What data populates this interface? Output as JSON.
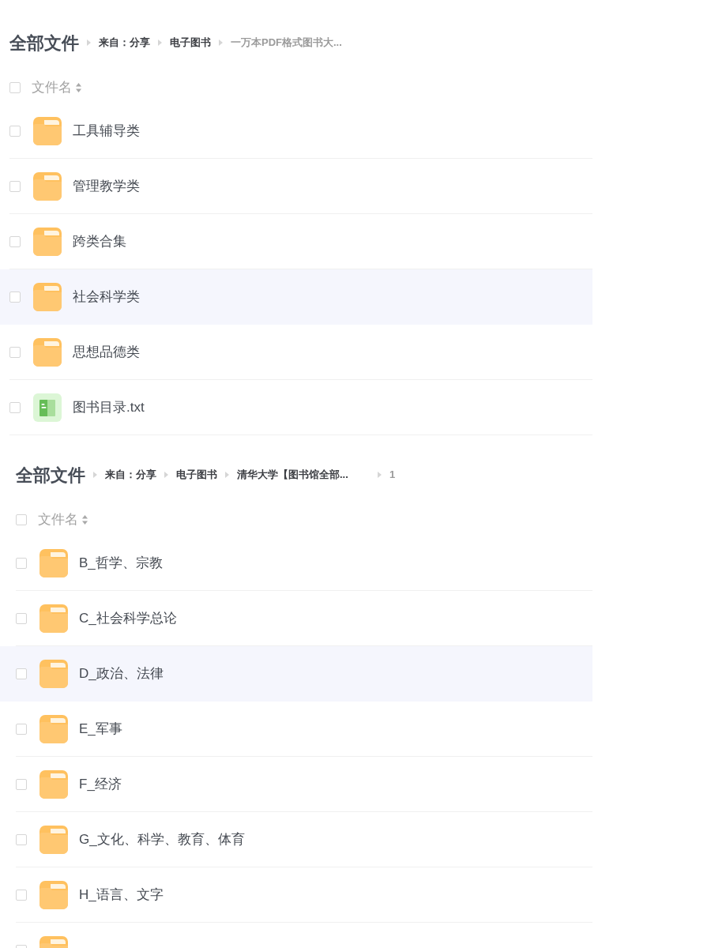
{
  "sections": [
    {
      "breadcrumb": {
        "root": "全部文件",
        "items": [
          {
            "label": "来自：分享",
            "current": false
          },
          {
            "label": "电子图书",
            "current": false
          },
          {
            "label": "一万本PDF格式图书大...",
            "current": true
          }
        ]
      },
      "header": {
        "label": "文件名",
        "checked": false
      },
      "rows": [
        {
          "kind": "folder",
          "name": "工具辅导类",
          "checked": false,
          "highlighted": false
        },
        {
          "kind": "folder",
          "name": "管理教学类",
          "checked": false,
          "highlighted": false
        },
        {
          "kind": "folder",
          "name": "跨类合集",
          "checked": false,
          "highlighted": false
        },
        {
          "kind": "folder",
          "name": "社会科学类",
          "checked": false,
          "highlighted": true
        },
        {
          "kind": "folder",
          "name": "思想品德类",
          "checked": false,
          "highlighted": false
        },
        {
          "kind": "txt",
          "name": "图书目录.txt",
          "checked": false,
          "highlighted": false
        }
      ]
    },
    {
      "breadcrumb": {
        "root": "全部文件",
        "items": [
          {
            "label": "来自：分享",
            "current": false
          },
          {
            "label": "电子图书",
            "current": false
          },
          {
            "label": "清华大学【图书馆全部...",
            "current": false
          },
          {
            "label": "1",
            "current": true
          }
        ]
      },
      "header": {
        "label": "文件名",
        "checked": false
      },
      "rows": [
        {
          "kind": "folder",
          "name": "B_哲学、宗教",
          "checked": false,
          "highlighted": false
        },
        {
          "kind": "folder",
          "name": "C_社会科学总论",
          "checked": false,
          "highlighted": false
        },
        {
          "kind": "folder",
          "name": "D_政治、法律",
          "checked": false,
          "highlighted": true
        },
        {
          "kind": "folder",
          "name": "E_军事",
          "checked": false,
          "highlighted": false
        },
        {
          "kind": "folder",
          "name": "F_经济",
          "checked": false,
          "highlighted": false
        },
        {
          "kind": "folder",
          "name": "G_文化、科学、教育、体育",
          "checked": false,
          "highlighted": false
        },
        {
          "kind": "folder",
          "name": "H_语言、文字",
          "checked": false,
          "highlighted": false
        },
        {
          "kind": "folder",
          "checked": false
        }
      ]
    }
  ]
}
